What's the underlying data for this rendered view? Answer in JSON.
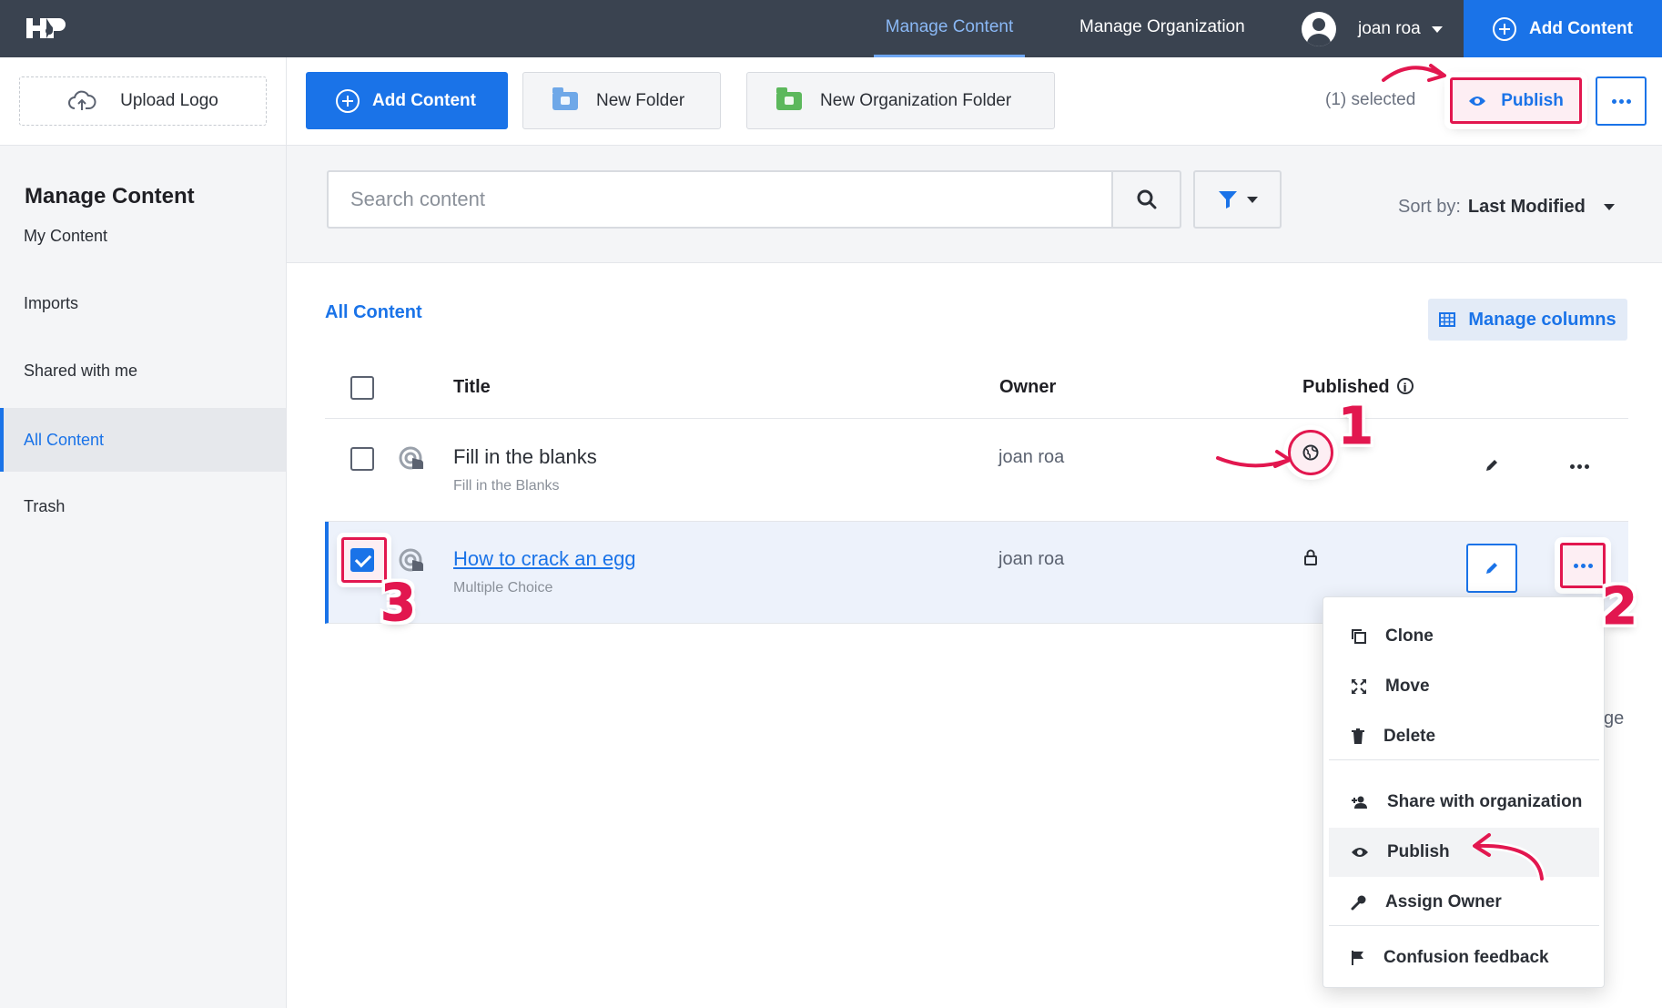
{
  "topbar": {
    "logo_text": "H5P",
    "nav": [
      "Manage Content",
      "Manage Organization"
    ],
    "user_name": "joan roa",
    "add_content": "Add Content"
  },
  "toolbar": {
    "upload_logo": "Upload Logo",
    "add_content": "Add Content",
    "new_folder": "New Folder",
    "new_org_folder": "New Organization Folder",
    "selected": "(1) selected",
    "publish": "Publish"
  },
  "sidebar": {
    "title": "Manage Content",
    "items": [
      "My Content",
      "Imports",
      "Shared with me",
      "All Content",
      "Trash"
    ],
    "active_index": 3
  },
  "search": {
    "placeholder": "Search content",
    "sort_label": "Sort by:",
    "sort_value": "Last Modified"
  },
  "content": {
    "heading": "All Content",
    "manage_columns": "Manage columns",
    "columns": [
      "Title",
      "Owner",
      "Published"
    ],
    "rows": [
      {
        "title": "Fill in the blanks",
        "type": "Fill in the Blanks",
        "owner": "joan roa",
        "published": "globe-icon",
        "selected": false
      },
      {
        "title": "How to crack an egg",
        "type": "Multiple Choice",
        "owner": "joan roa",
        "published": "lock-icon",
        "selected": true
      }
    ],
    "partial_text": "ge"
  },
  "menu": {
    "items": [
      "Clone",
      "Move",
      "Delete",
      "Share with organization",
      "Publish",
      "Assign Owner",
      "Confusion feedback"
    ],
    "icons": [
      "copy-icon",
      "move-icon",
      "trash-icon",
      "share-user-icon",
      "eye-icon",
      "key-icon",
      "flag-icon"
    ]
  },
  "annotations": [
    "1",
    "2",
    "3"
  ],
  "colors": {
    "accent": "#1a73e8",
    "topbar": "#3a4350",
    "highlight": "#e2174f"
  }
}
